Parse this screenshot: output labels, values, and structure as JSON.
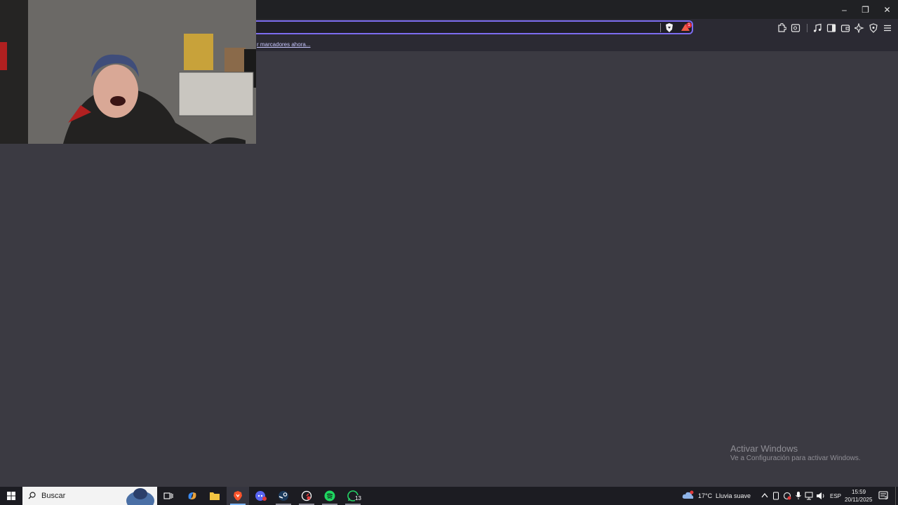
{
  "window": {
    "minimize_glyph": "–",
    "restore_glyph": "❐",
    "close_glyph": "✕"
  },
  "toolbar": {
    "url_value": "",
    "rewards_badge": "1",
    "icons": [
      "shield-icon",
      "rewards-icon",
      "extensions-icon",
      "tab-search-icon",
      "media-icon",
      "sidebar-icon",
      "wallet-icon",
      "leo-ai-icon",
      "vpn-icon",
      "menu-icon"
    ]
  },
  "bookmarks": {
    "link_text": "r marcadores ahora..."
  },
  "watermark": {
    "line1": "Activar Windows",
    "line2": "Ve a Configuración para activar Windows."
  },
  "taskbar": {
    "search_placeholder": "Buscar",
    "apps": [
      "task-view",
      "copilot",
      "file-explorer",
      "brave-browser",
      "discord",
      "steam",
      "stopwatch-app",
      "spotify",
      "whatsapp"
    ],
    "whatsapp_badge": "13",
    "weather_temp": "17°C",
    "weather_desc": "Lluvia suave",
    "language": "ESP",
    "time": "15:59",
    "date": "20/11/2025",
    "notification_count": "5"
  },
  "colors": {
    "accent": "#7c6cf0",
    "page_bg": "#3b3a42",
    "toolbar_bg": "#2b2a33"
  }
}
